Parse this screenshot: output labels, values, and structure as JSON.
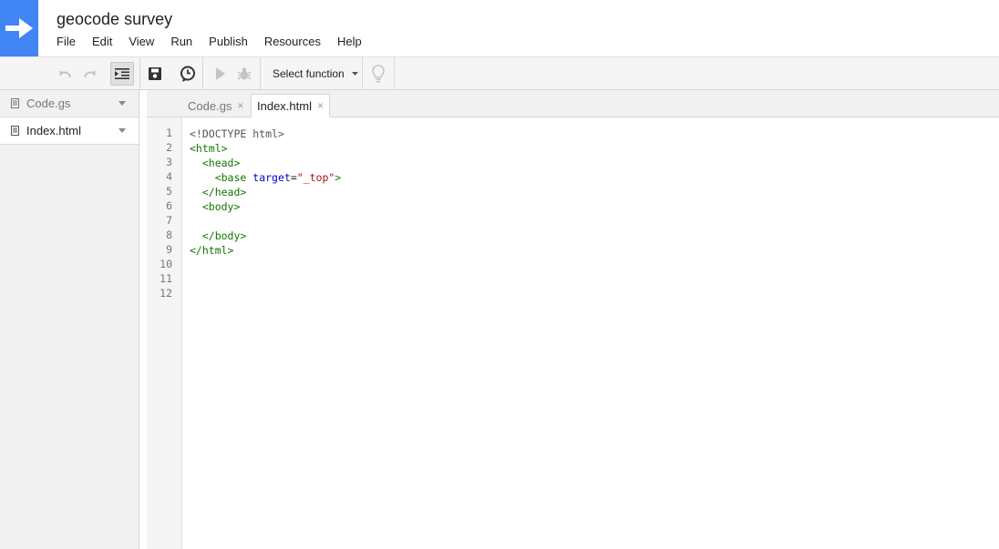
{
  "app": {
    "title": "geocode survey"
  },
  "menu": [
    "File",
    "Edit",
    "View",
    "Run",
    "Publish",
    "Resources",
    "Help"
  ],
  "toolbar": {
    "select_function_label": "Select function",
    "icons": [
      "undo-icon",
      "redo-icon",
      "indent-icon",
      "save-icon",
      "triggers-icon",
      "run-icon",
      "debug-icon",
      "lightbulb-icon"
    ]
  },
  "sidebar": {
    "files": [
      {
        "name": "Code.gs",
        "selected": false
      },
      {
        "name": "Index.html",
        "selected": true
      }
    ]
  },
  "tabs": [
    {
      "label": "Code.gs",
      "close": "×",
      "active": false
    },
    {
      "label": "Index.html",
      "close": "×",
      "active": true
    }
  ],
  "editor": {
    "line_numbers": [
      "1",
      "2",
      "3",
      "4",
      "5",
      "6",
      "7",
      "8",
      "9",
      "10",
      "11",
      "12"
    ],
    "lines": [
      [
        {
          "t": "<!DOCTYPE html>",
          "c": "meta"
        }
      ],
      [
        {
          "t": "<html>",
          "c": "tag"
        }
      ],
      [
        {
          "t": "  ",
          "c": "plain"
        },
        {
          "t": "<head>",
          "c": "tag"
        }
      ],
      [
        {
          "t": "    ",
          "c": "plain"
        },
        {
          "t": "<base",
          "c": "tag"
        },
        {
          "t": " ",
          "c": "plain"
        },
        {
          "t": "target",
          "c": "attr"
        },
        {
          "t": "=",
          "c": "plain"
        },
        {
          "t": "\"_top\"",
          "c": "str"
        },
        {
          "t": ">",
          "c": "tag"
        }
      ],
      [
        {
          "t": "  ",
          "c": "plain"
        },
        {
          "t": "</head>",
          "c": "tag"
        }
      ],
      [
        {
          "t": "  ",
          "c": "plain"
        },
        {
          "t": "<body>",
          "c": "tag"
        }
      ],
      [],
      [
        {
          "t": "  ",
          "c": "plain"
        },
        {
          "t": "</body>",
          "c": "tag"
        }
      ],
      [
        {
          "t": "</html>",
          "c": "tag"
        }
      ],
      [],
      [],
      []
    ]
  }
}
